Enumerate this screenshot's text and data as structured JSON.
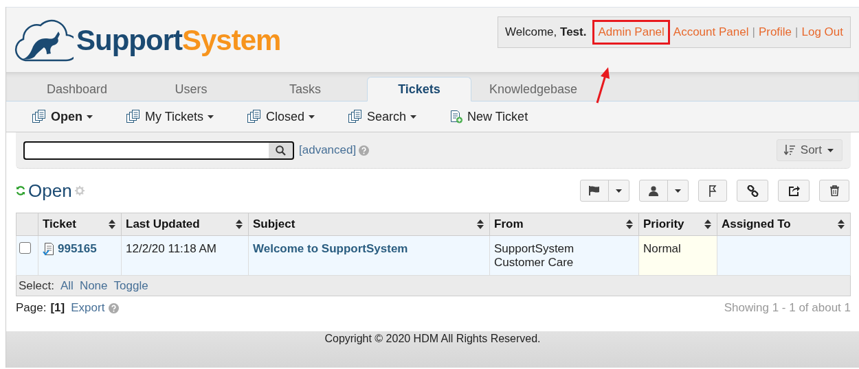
{
  "logo": {
    "primary": "Support",
    "secondary": "System"
  },
  "user_panel": {
    "welcome": "Welcome, **Test.**",
    "annotation_arrow": true,
    "items": [
      {
        "kind": "link",
        "label": "Admin Panel",
        "highlighted": true
      },
      {
        "kind": "link",
        "label": "Account Panel",
        "highlighted": false
      },
      {
        "kind": "separator",
        "label": "|"
      },
      {
        "kind": "link",
        "label": "Profile",
        "highlighted": false
      },
      {
        "kind": "separator",
        "label": "|"
      },
      {
        "kind": "link",
        "label": "Log Out",
        "highlighted": false
      }
    ]
  },
  "tabs": [
    {
      "label": "Dashboard",
      "selected": false
    },
    {
      "label": "Users",
      "selected": false
    },
    {
      "label": "Tasks",
      "selected": false
    },
    {
      "label": "Tickets",
      "selected": true
    },
    {
      "label": "Knowledgebase",
      "selected": false
    }
  ],
  "toolbar": [
    {
      "label": "Open",
      "kind": "menu",
      "selected": true
    },
    {
      "label": "My Tickets",
      "kind": "menu",
      "selected": false
    },
    {
      "label": "Closed",
      "kind": "menu",
      "selected": false
    },
    {
      "label": "Search",
      "kind": "menu",
      "selected": false
    },
    {
      "label": "New Ticket",
      "kind": "action",
      "selected": false
    }
  ],
  "search": {
    "advanced_link": "[advanced]"
  },
  "sort_button": {
    "label": "Sort"
  },
  "view_title": "Open",
  "table": {
    "columns": [
      {
        "kind": "id",
        "label": "Ticket",
        "sortable": true
      },
      {
        "kind": "text",
        "label": "Last Updated",
        "sortable": true
      },
      {
        "kind": "link",
        "label": "Subject",
        "sortable": true
      },
      {
        "kind": "text",
        "label": "From",
        "sortable": true
      },
      {
        "kind": "priority",
        "label": "Priority",
        "sortable": true
      },
      {
        "kind": "text",
        "label": "Assigned To",
        "sortable": true
      }
    ],
    "rows": [
      {
        "selected": false,
        "cells": [
          "995165",
          "12/2/20 11:18 AM",
          "Welcome to SupportSystem",
          "SupportSystem Customer Care",
          "Normal"
        ]
      }
    ]
  },
  "select_bar": {
    "label": "Select:",
    "links": [
      "All",
      "None",
      "Toggle"
    ]
  },
  "pager": {
    "label": "Page:",
    "current": "[1]",
    "export": "Export",
    "summary": "Showing 1 - 1 of about 1"
  },
  "footer": "Copyright © 2020 HDM All Rights Reserved."
}
